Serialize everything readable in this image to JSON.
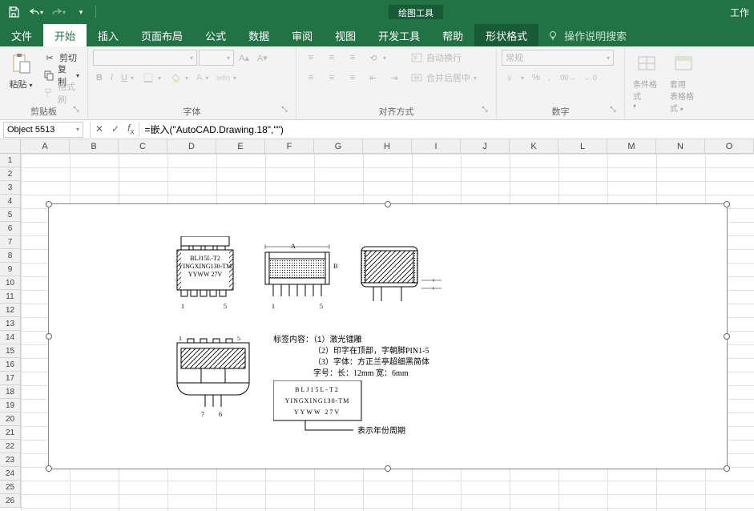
{
  "qat": {
    "save": "save",
    "undo": "undo",
    "redo": "redo"
  },
  "titlebar": {
    "tools_label": "绘图工具",
    "workbook_label": "工作"
  },
  "tabs": {
    "file": "文件",
    "home": "开始",
    "insert": "插入",
    "page_layout": "页面布局",
    "formulas": "公式",
    "data": "数据",
    "review": "审阅",
    "view": "视图",
    "dev": "开发工具",
    "help": "帮助",
    "shape_format": "形状格式",
    "tell_me": "操作说明搜索"
  },
  "ribbon": {
    "clipboard": {
      "label": "剪贴板",
      "paste": "粘贴",
      "cut": "剪切",
      "copy": "复制",
      "format_painter": "格式刷"
    },
    "font": {
      "label": "字体"
    },
    "alignment": {
      "label": "对齐方式",
      "wrap": "自动换行",
      "merge": "合并后居中"
    },
    "number": {
      "label": "数字",
      "general": "常规"
    },
    "styles": {
      "cond_fmt": "条件格式",
      "table_fmt": "套用\n表格格式"
    }
  },
  "name_box": "Object 5513",
  "formula": "=嵌入(\"AutoCAD.Drawing.18\",\"\")",
  "columns": [
    "A",
    "B",
    "C",
    "D",
    "E",
    "F",
    "G",
    "H",
    "I",
    "J",
    "K",
    "L",
    "M",
    "N",
    "O"
  ],
  "rows": [
    "1",
    "2",
    "3",
    "4",
    "5",
    "6",
    "7",
    "8",
    "9",
    "10",
    "11",
    "12",
    "13",
    "14",
    "15",
    "16",
    "17",
    "18",
    "19",
    "20",
    "21",
    "22",
    "23",
    "24",
    "25",
    "26"
  ],
  "drawing": {
    "block1": {
      "line1": "BLJ15L-T2",
      "line2": "YINGXING130-TM",
      "line3": "YYWW  27V",
      "pin1": "1",
      "pin5": "5"
    },
    "block2": {
      "pin1": "1",
      "pin5": "5",
      "a": "A",
      "b": "B"
    },
    "block4": {
      "pin1": "1",
      "pin5": "5",
      "pin6": "6",
      "pin7": "7"
    },
    "notes": {
      "title": "标签内容：",
      "n1": "（1）激光镭雕",
      "n2": "（2）印字在顶部，字朝脚PIN1-5",
      "n3": "（3）字体：方正兰亭超细黑简体",
      "n4": "        字号：长：12mm 宽：6mm"
    },
    "label_box": {
      "l1": "BLJ15L-T2",
      "l2": "YINGXING130-TM",
      "l3": "YYWW   27V"
    },
    "footer": "表示年份周期"
  }
}
